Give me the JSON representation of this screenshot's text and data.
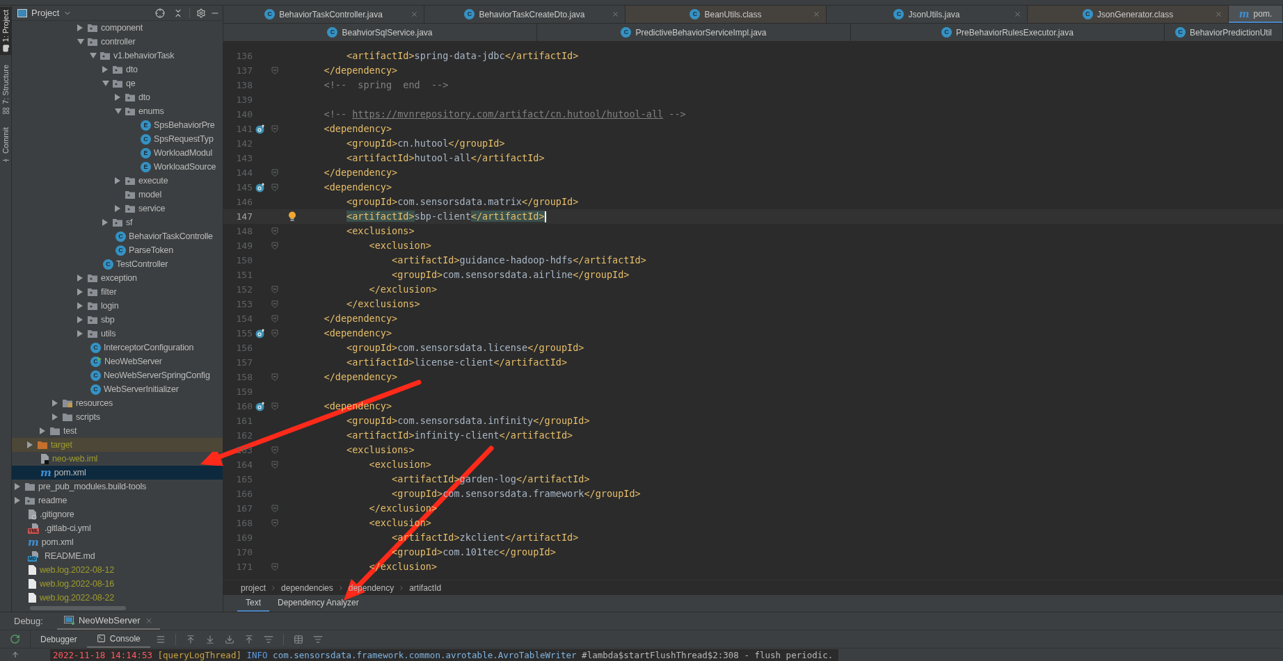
{
  "tool_strip": [
    {
      "label": "1: Project",
      "kind": "project",
      "selected": true
    },
    {
      "label": "7: Structure",
      "kind": "structure",
      "selected": false
    },
    {
      "label": "Commit",
      "kind": "commit",
      "selected": false
    }
  ],
  "project_panel": {
    "title": "Project",
    "tree": [
      {
        "children": [
          {
            "children": [
              {
                "children": [
                  {
                    "children": [
                      {
                        "children": [
                          {
                            "label": "component",
                            "kind": "package",
                            "expanded": false,
                            "selected": false
                          },
                          {
                            "label": "controller",
                            "kind": "package",
                            "expanded": true,
                            "selected": false,
                            "children": [
                              {
                                "label": "v1.behaviorTask",
                                "kind": "package",
                                "expanded": true,
                                "selected": false,
                                "children": [
                                  {
                                    "label": "dto",
                                    "kind": "package",
                                    "expanded": false,
                                    "selected": false
                                  },
                                  {
                                    "label": "qe",
                                    "kind": "package",
                                    "expanded": true,
                                    "selected": false,
                                    "children": [
                                      {
                                        "label": "dto",
                                        "kind": "package",
                                        "expanded": false,
                                        "selected": false
                                      },
                                      {
                                        "label": "enums",
                                        "kind": "package",
                                        "expanded": true,
                                        "selected": false,
                                        "children": [
                                          {
                                            "label": "SpsBehaviorPre",
                                            "kind": "class",
                                            "badge": "E",
                                            "selected": false
                                          },
                                          {
                                            "label": "SpsRequestTyp",
                                            "kind": "class",
                                            "badge": "C",
                                            "selected": false
                                          },
                                          {
                                            "label": "WorkloadModul",
                                            "kind": "class",
                                            "badge": "E",
                                            "selected": false
                                          },
                                          {
                                            "label": "WorkloadSource",
                                            "kind": "class",
                                            "badge": "E",
                                            "selected": false
                                          }
                                        ]
                                      },
                                      {
                                        "label": "execute",
                                        "kind": "package",
                                        "expanded": false,
                                        "selected": false
                                      },
                                      {
                                        "label": "model",
                                        "kind": "package",
                                        "selected": false
                                      },
                                      {
                                        "label": "service",
                                        "kind": "package",
                                        "expanded": false,
                                        "selected": false
                                      }
                                    ]
                                  },
                                  {
                                    "label": "sf",
                                    "kind": "package",
                                    "expanded": false,
                                    "selected": false
                                  },
                                  {
                                    "label": "BehaviorTaskControlle",
                                    "kind": "class",
                                    "badge": "C",
                                    "selected": false
                                  },
                                  {
                                    "label": "ParseToken",
                                    "kind": "class",
                                    "badge": "C",
                                    "selected": false
                                  }
                                ]
                              },
                              {
                                "label": "TestController",
                                "kind": "class",
                                "badge": "C",
                                "selected": false
                              }
                            ]
                          },
                          {
                            "label": "exception",
                            "kind": "package",
                            "expanded": false,
                            "selected": false
                          },
                          {
                            "label": "filter",
                            "kind": "package",
                            "expanded": false,
                            "selected": false
                          },
                          {
                            "label": "login",
                            "kind": "package",
                            "expanded": false,
                            "selected": false
                          },
                          {
                            "label": "sbp",
                            "kind": "package",
                            "expanded": false,
                            "selected": false
                          },
                          {
                            "label": "utils",
                            "kind": "package",
                            "expanded": false,
                            "selected": false
                          },
                          {
                            "label": "InterceptorConfiguration",
                            "kind": "class",
                            "badge": "C",
                            "selected": false
                          },
                          {
                            "label": "NeoWebServer",
                            "kind": "runnable",
                            "badge": "C",
                            "selected": false
                          },
                          {
                            "label": "NeoWebServerSpringConfig",
                            "kind": "class",
                            "badge": "C",
                            "selected": false
                          },
                          {
                            "label": "WebServerInitializer",
                            "kind": "class",
                            "badge": "C",
                            "selected": false
                          }
                        ]
                      }
                    ]
                  },
                  {
                    "label": "resources",
                    "kind": "resources",
                    "expanded": false,
                    "selected": false
                  },
                  {
                    "label": "scripts",
                    "kind": "folder",
                    "expanded": false,
                    "selected": false
                  }
                ]
              },
              {
                "label": "test",
                "kind": "folder",
                "expanded": false,
                "selected": false
              }
            ]
          },
          {
            "label": "target",
            "kind": "excluded",
            "expanded": false,
            "selected": false,
            "color": "#9e9d2e"
          },
          {
            "label": "neo-web.iml",
            "kind": "iml",
            "selected": false,
            "color": "#9e9d2e"
          },
          {
            "label": "pom.xml",
            "kind": "maven",
            "badge": "m",
            "selected": true
          }
        ]
      },
      {
        "label": "pre_pub_modules.build-tools",
        "kind": "folder",
        "expanded": false,
        "selected": false
      },
      {
        "label": "readme",
        "kind": "package",
        "expanded": false,
        "selected": false
      },
      {
        "label": ".gitignore",
        "kind": "gitignore",
        "selected": false
      },
      {
        "label": ".gitlab-ci.yml",
        "kind": "yml",
        "badge": "YML",
        "selected": false
      },
      {
        "label": "pom.xml",
        "kind": "maven",
        "badge": "m",
        "selected": false
      },
      {
        "label": "README.md",
        "kind": "md",
        "badge": "MD",
        "selected": false
      },
      {
        "label": "web.log.2022-08-12",
        "kind": "text",
        "selected": false,
        "color": "#9e9d2e"
      },
      {
        "label": "web.log.2022-08-16",
        "kind": "text",
        "selected": false,
        "color": "#9e9d2e"
      },
      {
        "label": "web.log.2022-08-22",
        "kind": "text",
        "selected": false,
        "color": "#9e9d2e"
      }
    ]
  },
  "editor_tabs": [
    [
      {
        "label": "BehaviorTaskController.java",
        "kind": "java",
        "badge": "C",
        "selected": false
      },
      {
        "label": "BehaviorTaskCreateDto.java",
        "kind": "java",
        "badge": "C",
        "selected": false
      },
      {
        "label": "BeanUtils.class",
        "kind": "library",
        "badge": "C",
        "selected": false
      },
      {
        "label": "JsonUtils.java",
        "kind": "java",
        "badge": "C",
        "selected": false
      },
      {
        "label": "JsonGenerator.class",
        "kind": "library",
        "badge": "C",
        "selected": false
      },
      {
        "label": "pom.",
        "kind": "maven",
        "badge": "m",
        "selected": true
      }
    ],
    [
      {
        "label": "BeahviorSqlService.java",
        "kind": "java",
        "badge": "C",
        "selected": false
      },
      {
        "label": "PredictiveBehaviorServiceImpl.java",
        "kind": "java",
        "badge": "C",
        "selected": false
      },
      {
        "label": "PreBehaviorRulesExecutor.java",
        "kind": "java",
        "badge": "C",
        "selected": false
      },
      {
        "label": "BehaviorPredictionUtil",
        "kind": "java",
        "badge": "C",
        "selected": false
      }
    ]
  ],
  "code_lines": [
    {
      "number": "136",
      "code": "        <artifactId>spring-data-jdbc</artifactId>",
      "kind": "plain",
      "fold": false,
      "current": false
    },
    {
      "number": "137",
      "code": "    </dependency>",
      "kind": "plain",
      "fold": true,
      "current": false
    },
    {
      "number": "138",
      "code": "    <!--  spring  end  -->",
      "kind": "plain",
      "fold": false,
      "current": false
    },
    {
      "number": "139",
      "kind": "plain",
      "fold": false,
      "current": false
    },
    {
      "number": "140",
      "code": "    <!-- https://mvnrepository.com/artifact/cn.hutool/hutool-all -->",
      "kind": "plain",
      "fold": false,
      "current": false
    },
    {
      "number": "141",
      "code": "    <dependency>",
      "kind": "override",
      "fold": true,
      "current": false
    },
    {
      "number": "142",
      "code": "        <groupId>cn.hutool</groupId>",
      "kind": "plain",
      "fold": false,
      "current": false
    },
    {
      "number": "143",
      "code": "        <artifactId>hutool-all</artifactId>",
      "kind": "plain",
      "fold": false,
      "current": false
    },
    {
      "number": "144",
      "code": "    </dependency>",
      "kind": "plain",
      "fold": true,
      "current": false
    },
    {
      "number": "145",
      "code": "    <dependency>",
      "kind": "override",
      "fold": true,
      "current": false
    },
    {
      "number": "146",
      "code": "        <groupId>com.sensorsdata.matrix</groupId>",
      "kind": "plain",
      "fold": false,
      "current": false
    },
    {
      "number": "147",
      "code": "        <artifactId>sbp-client</artifactId>",
      "kind": "bulb",
      "fold": false,
      "current": true
    },
    {
      "number": "148",
      "code": "        <exclusions>",
      "kind": "plain",
      "fold": true,
      "current": false
    },
    {
      "number": "149",
      "code": "            <exclusion>",
      "kind": "plain",
      "fold": true,
      "current": false
    },
    {
      "number": "150",
      "code": "                <artifactId>guidance-hadoop-hdfs</artifactId>",
      "kind": "plain",
      "fold": false,
      "current": false
    },
    {
      "number": "151",
      "code": "                <groupId>com.sensorsdata.airline</groupId>",
      "kind": "plain",
      "fold": false,
      "current": false
    },
    {
      "number": "152",
      "code": "            </exclusion>",
      "kind": "plain",
      "fold": true,
      "current": false
    },
    {
      "number": "153",
      "code": "        </exclusions>",
      "kind": "plain",
      "fold": true,
      "current": false
    },
    {
      "number": "154",
      "code": "    </dependency>",
      "kind": "plain",
      "fold": true,
      "current": false
    },
    {
      "number": "155",
      "code": "    <dependency>",
      "kind": "override",
      "fold": true,
      "current": false
    },
    {
      "number": "156",
      "code": "        <groupId>com.sensorsdata.license</groupId>",
      "kind": "plain",
      "fold": false,
      "current": false
    },
    {
      "number": "157",
      "code": "        <artifactId>license-client</artifactId>",
      "kind": "plain",
      "fold": false,
      "current": false
    },
    {
      "number": "158",
      "code": "    </dependency>",
      "kind": "plain",
      "fold": true,
      "current": false
    },
    {
      "number": "159",
      "kind": "plain",
      "fold": false,
      "current": false
    },
    {
      "number": "160",
      "code": "    <dependency>",
      "kind": "override",
      "fold": true,
      "current": false
    },
    {
      "number": "161",
      "code": "        <groupId>com.sensorsdata.infinity</groupId>",
      "kind": "plain",
      "fold": false,
      "current": false
    },
    {
      "number": "162",
      "code": "        <artifactId>infinity-client</artifactId>",
      "kind": "plain",
      "fold": false,
      "current": false
    },
    {
      "number": "163",
      "code": "        <exclusions>",
      "kind": "plain",
      "fold": true,
      "current": false
    },
    {
      "number": "164",
      "code": "            <exclusion>",
      "kind": "plain",
      "fold": true,
      "current": false
    },
    {
      "number": "165",
      "code": "                <artifactId>garden-log</artifactId>",
      "kind": "plain",
      "fold": false,
      "current": false
    },
    {
      "number": "166",
      "code": "                <groupId>com.sensorsdata.framework</groupId>",
      "kind": "plain",
      "fold": false,
      "current": false
    },
    {
      "number": "167",
      "code": "            </exclusion>",
      "kind": "plain",
      "fold": true,
      "current": false
    },
    {
      "number": "168",
      "code": "            <exclusion>",
      "kind": "plain",
      "fold": true,
      "current": false
    },
    {
      "number": "169",
      "code": "                <artifactId>zkclient</artifactId>",
      "kind": "plain",
      "fold": false,
      "current": false
    },
    {
      "number": "170",
      "code": "                <groupId>com.101tec</groupId>",
      "kind": "plain",
      "fold": false,
      "current": false
    },
    {
      "number": "171",
      "code": "            </exclusion>",
      "kind": "plain",
      "fold": true,
      "current": false
    }
  ],
  "breadcrumb": [
    "project",
    "dependencies",
    "dependency",
    "artifactId"
  ],
  "view_tabs": [
    {
      "label": "Text",
      "selected": true
    },
    {
      "label": "Dependency Analyzer",
      "selected": false
    }
  ],
  "debug": {
    "label": "Debug:",
    "sessions": [
      {
        "label": "NeoWebServer",
        "selected": true
      }
    ],
    "tabs": [
      {
        "label": "Debugger",
        "kind": "debugger",
        "selected": false
      },
      {
        "label": "Console",
        "kind": "console",
        "selected": true
      }
    ],
    "log": [
      {
        "text": "2022-11-18 14:14:53",
        "color": "#ff5a5f"
      },
      {
        "text": "[queryLogThread]",
        "color": "#c9a445"
      },
      {
        "text": "INFO",
        "color": "#5c9ce6"
      },
      {
        "text": "com.sensorsdata.framework.common.avrotable.AvroTableWriter",
        "color": "#7fb3e0"
      },
      {
        "text": "#lambda$startFlushThread$2:308",
        "color": "#b8b8b8"
      },
      {
        "text": "- flush periodic.",
        "color": "#b8b8b8"
      }
    ]
  }
}
